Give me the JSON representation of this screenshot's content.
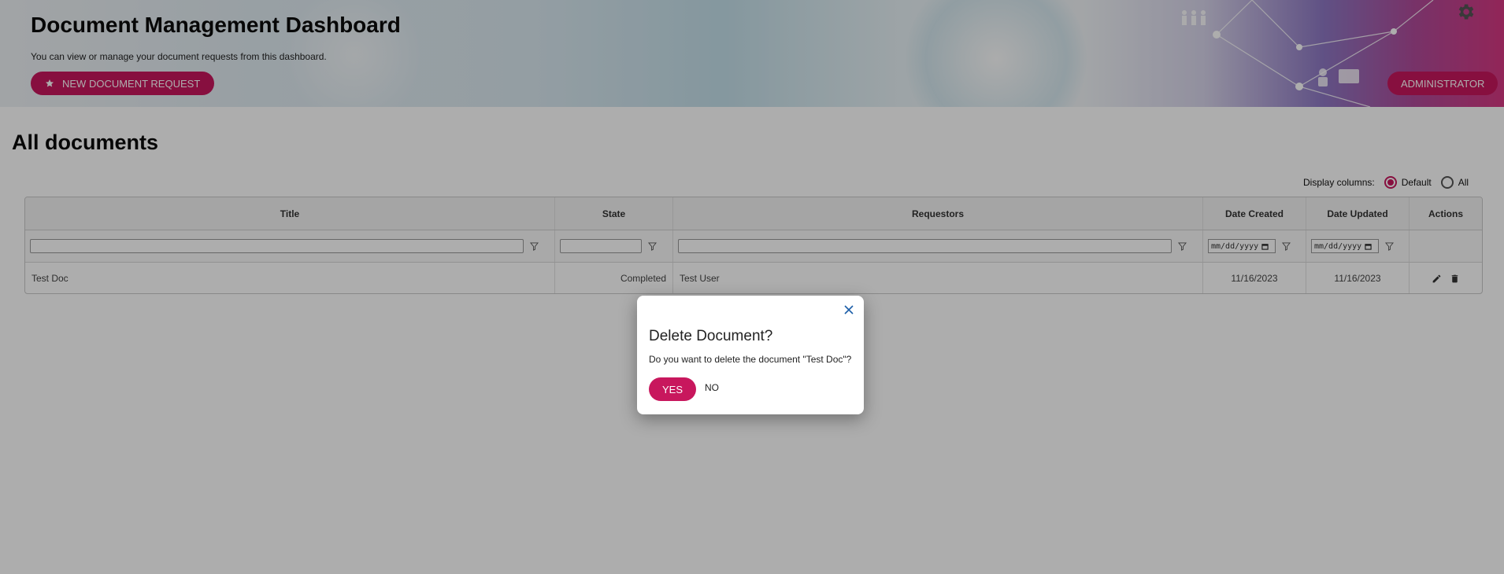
{
  "header": {
    "title": "Document Management Dashboard",
    "subtitle": "You can view or manage your document requests from this dashboard.",
    "new_request_label": "NEW DOCUMENT REQUEST",
    "admin_label": "ADMINISTRATOR"
  },
  "main": {
    "section_title": "All documents",
    "display_columns": {
      "label": "Display columns:",
      "options": [
        "Default",
        "All"
      ],
      "selected": "Default"
    }
  },
  "table": {
    "columns": [
      "Title",
      "State",
      "Requestors",
      "Date Created",
      "Date Updated",
      "Actions"
    ],
    "date_placeholder": "mm/dd/yyyy",
    "rows": [
      {
        "title": "Test Doc",
        "state": "Completed",
        "requestors": "Test User",
        "date_created": "11/16/2023",
        "date_updated": "11/16/2023"
      }
    ]
  },
  "dialog": {
    "title": "Delete Document?",
    "message": "Do you want to delete the document \"Test Doc\"?",
    "yes_label": "YES",
    "no_label": "NO"
  },
  "colors": {
    "accent": "#c8175d",
    "overlay": "rgba(0,0,0,0.32)"
  },
  "icons": [
    "gear-icon",
    "star-icon",
    "filter-icon",
    "calendar-icon",
    "edit-icon",
    "delete-icon",
    "close-icon"
  ]
}
